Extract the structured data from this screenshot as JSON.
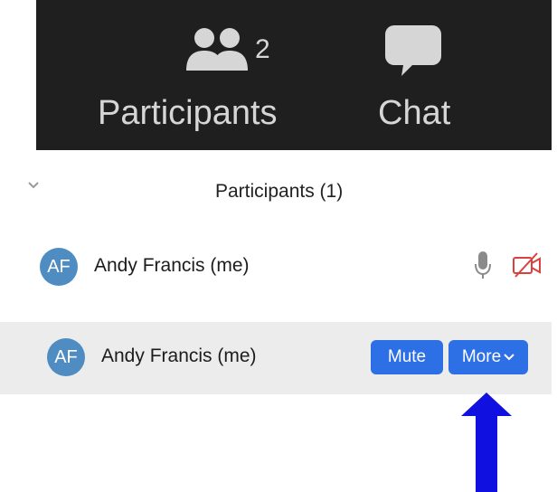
{
  "toolbar": {
    "participants": {
      "icon": "participants-icon",
      "count": "2",
      "label": "Participants"
    },
    "chat": {
      "icon": "chat-bubble-icon",
      "label": "Chat"
    },
    "background_color": "#1f1f1f"
  },
  "section": {
    "collapse_icon": "chevron-down-icon",
    "title": "Participants (1)"
  },
  "participants": [
    {
      "initials": "AF",
      "name": "Andy Francis (me)",
      "mic_icon": "microphone-icon",
      "video_icon": "video-off-icon",
      "avatar_color": "#4e8cc2"
    }
  ],
  "hover_row": {
    "initials": "AF",
    "name": "Andy Francis (me)",
    "mute_label": "Mute",
    "more_label": "More",
    "button_color": "#2d6fe4",
    "row_color": "#ececec"
  },
  "annotation": {
    "icon": "up-arrow-icon",
    "color": "#1010e0"
  }
}
